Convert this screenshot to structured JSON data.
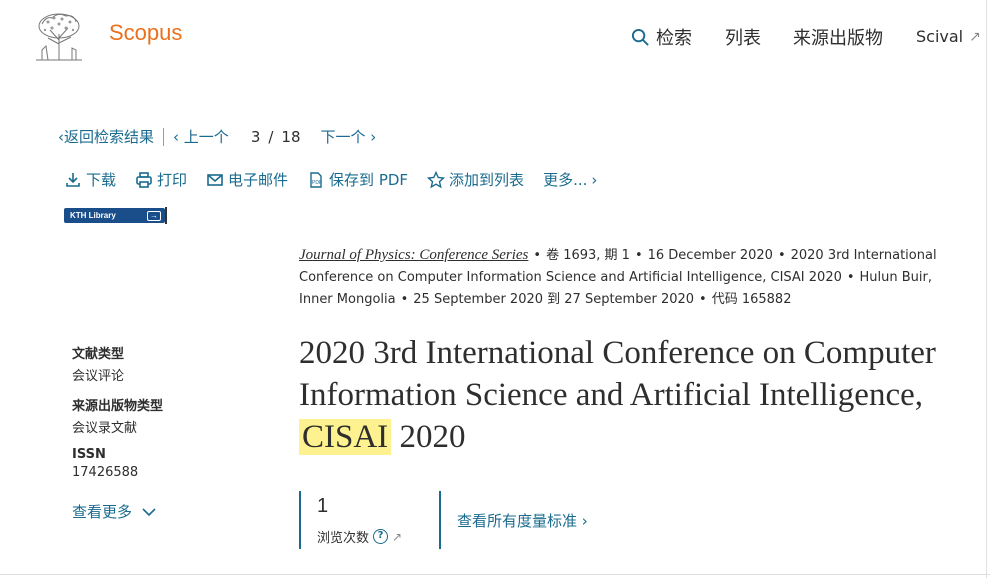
{
  "header": {
    "brand": "Scopus",
    "nav": {
      "search": "检索",
      "lists": "列表",
      "sources": "来源出版物",
      "scival": "Scival"
    }
  },
  "breadcrumb": {
    "back": "返回检索结果",
    "prev": "上一个",
    "current": "3",
    "total": "18",
    "next": "下一个"
  },
  "toolbar": {
    "download": "下载",
    "print": "打印",
    "email": "电子邮件",
    "save_pdf": "保存到 PDF",
    "add_list": "添加到列表",
    "more": "更多..."
  },
  "kth_badge": {
    "label": "KTH Library"
  },
  "source": {
    "journal": "Journal of Physics: Conference Series",
    "volume": "卷 1693, 期 1",
    "date": "16 December 2020",
    "conference": "2020 3rd International Conference on Computer Information Science and Artificial Intelligence, CISAI 2020",
    "location": "Hulun Buir, Inner Mongolia",
    "dates": "25 September 2020 到 27 September 2020",
    "code": "代码 165882"
  },
  "meta": {
    "doc_type_label": "文献类型",
    "doc_type_value": "会议评论",
    "source_type_label": "来源出版物类型",
    "source_type_value": "会议录文献",
    "issn_label": "ISSN",
    "issn_value": "17426588",
    "more": "查看更多"
  },
  "title": {
    "part1": "2020 3rd International Conference on Computer Information Science and Artificial Intelligence, ",
    "highlight": "CISAI",
    "part2": " 2020"
  },
  "metrics": {
    "views": "1",
    "views_label": "浏览次数",
    "all_metrics": "查看所有度量标准"
  },
  "colors": {
    "brand": "#e9711c",
    "link": "#1a6b8f",
    "highlight": "#fdf28f",
    "kth": "#1a4e8a"
  }
}
